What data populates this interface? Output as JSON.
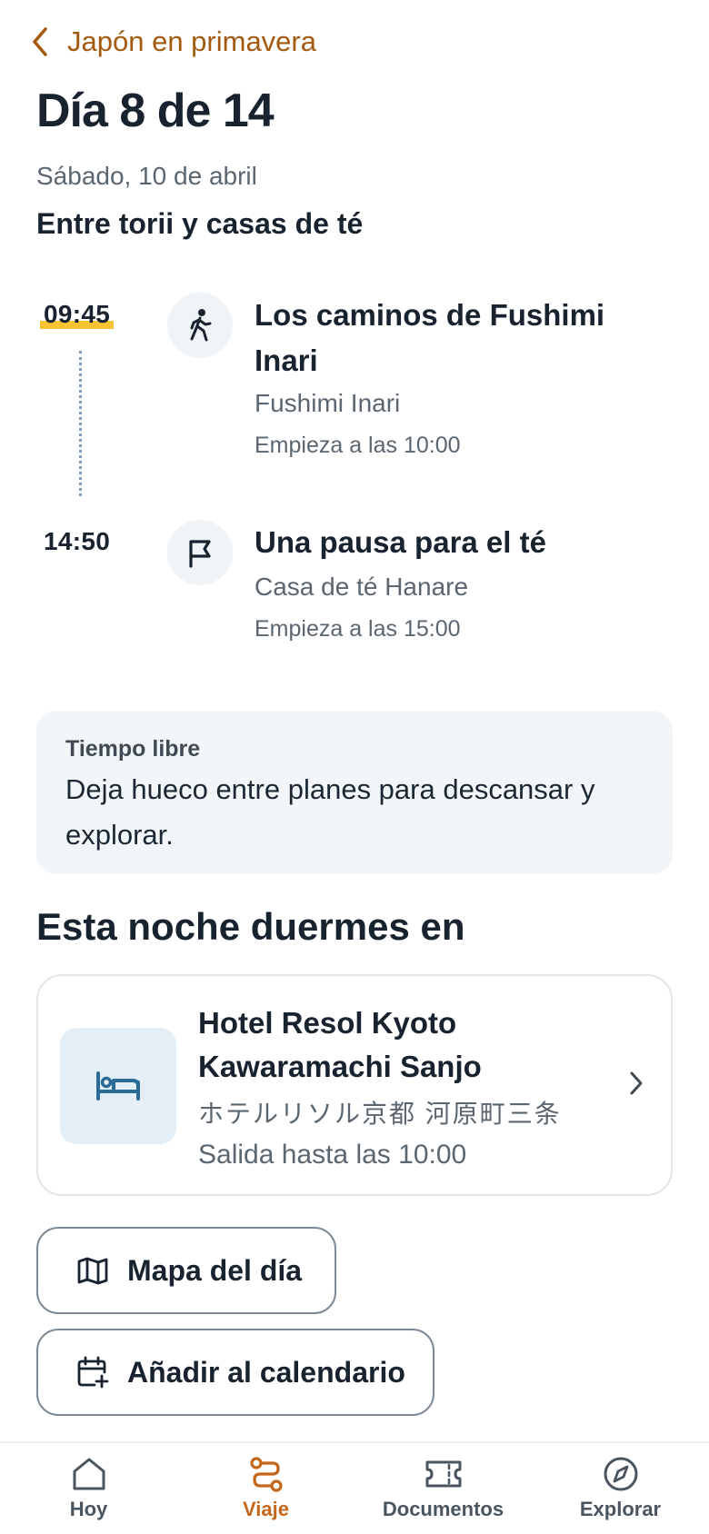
{
  "header": {
    "back_label": "Japón en primavera"
  },
  "day": {
    "title": "Día 8 de 14",
    "date": "Sábado, 10 de abril",
    "theme": "Entre torii y casas de té"
  },
  "activities": [
    {
      "time": "09:45",
      "icon": "walking-person-icon",
      "title": "Los caminos de Fushimi Inari",
      "place": "Fushimi Inari",
      "start": "Empieza a las 10:00"
    },
    {
      "time": "14:50",
      "icon": "flag-icon",
      "title": "Una pausa para el té",
      "place": "Casa de té Hanare",
      "start": "Empieza a las 15:00"
    }
  ],
  "free_time": {
    "label": "Tiempo libre",
    "text": "Deja hueco entre planes para descansar y explorar."
  },
  "sleep": {
    "section_title": "Esta noche duermes en",
    "hotel_name": "Hotel Resol Kyoto Kawaramachi Sanjo",
    "hotel_local_name": "ホテルリソル京都 河原町三条",
    "checkout": "Salida hasta las 10:00",
    "icon": "bed-icon"
  },
  "actions": {
    "map_label": "Mapa del día",
    "calendar_label": "Añadir al calendario"
  },
  "nav": {
    "items": [
      {
        "label": "Hoy",
        "icon": "home-icon",
        "active": false
      },
      {
        "label": "Viaje",
        "icon": "route-icon",
        "active": true
      },
      {
        "label": "Documentos",
        "icon": "ticket-icon",
        "active": false
      },
      {
        "label": "Explorar",
        "icon": "compass-icon",
        "active": false
      }
    ]
  },
  "colors": {
    "accent": "#c4671a",
    "back_link": "#a35a0f",
    "highlight": "#f6c430",
    "text": "#18232f",
    "muted": "#5b6670",
    "hotel_icon_bg": "#e3eef7",
    "hotel_icon": "#2b6c96"
  }
}
